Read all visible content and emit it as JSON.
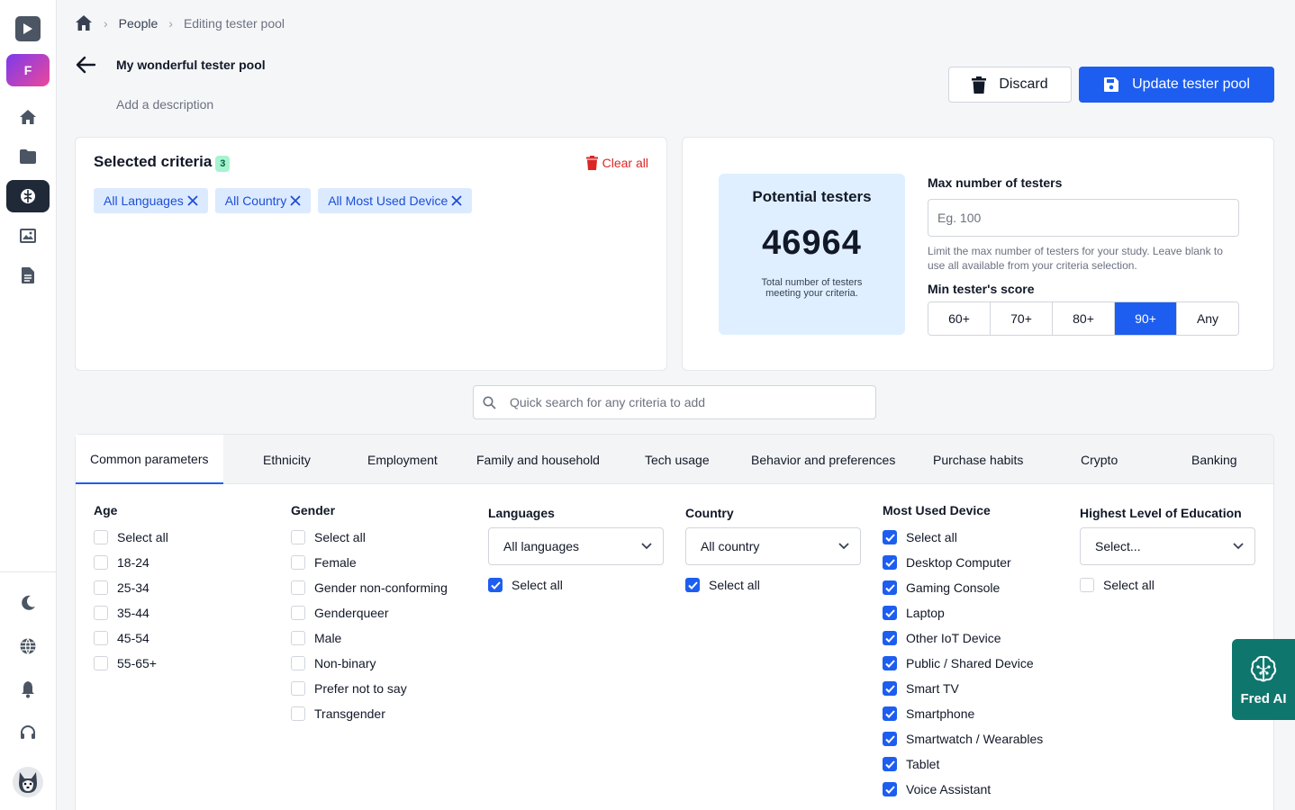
{
  "sidebar": {
    "workspace_initial": "F",
    "icons": [
      "play-logo-icon",
      "home-icon",
      "folder-icon",
      "brain-icon",
      "gallery-icon",
      "document-icon",
      "moon-icon",
      "globe-icon",
      "bell-icon",
      "headset-icon"
    ]
  },
  "breadcrumb": {
    "people": "People",
    "current": "Editing tester pool"
  },
  "pool": {
    "title": "My wonderful tester pool",
    "description_placeholder": "Add a description"
  },
  "actions": {
    "discard": "Discard",
    "update": "Update tester pool"
  },
  "criteria": {
    "title": "Selected criteria",
    "count": "3",
    "clear_all": "Clear all",
    "chips": [
      "All Languages",
      "All Country",
      "All Most Used Device"
    ]
  },
  "potential": {
    "title": "Potential testers",
    "count": "46964",
    "subtitle_line1": "Total number of testers",
    "subtitle_line2": "meeting your criteria.",
    "max_label": "Max number of testers",
    "max_placeholder": "Eg. 100",
    "max_help": "Limit the max number of testers for your study. Leave blank to use all available from your criteria selection.",
    "score_label": "Min tester's score",
    "scores": [
      "60+",
      "70+",
      "80+",
      "90+",
      "Any"
    ],
    "selected_score": "90+"
  },
  "search": {
    "placeholder": "Quick search for any criteria to add"
  },
  "tabs": [
    "Common parameters",
    "Ethnicity",
    "Employment",
    "Family and household",
    "Tech usage",
    "Behavior and preferences",
    "Purchase habits",
    "Crypto",
    "Banking"
  ],
  "params": {
    "age": {
      "title": "Age",
      "options": [
        "Select all",
        "18-24",
        "25-34",
        "35-44",
        "45-54",
        "55-65+"
      ]
    },
    "gender": {
      "title": "Gender",
      "options": [
        "Select all",
        "Female",
        "Gender non-conforming",
        "Genderqueer",
        "Male",
        "Non-binary",
        "Prefer not to say",
        "Transgender"
      ]
    },
    "languages": {
      "title": "Languages",
      "select_value": "All languages",
      "select_all": "Select all"
    },
    "country": {
      "title": "Country",
      "select_value": "All country",
      "select_all": "Select all"
    },
    "device": {
      "title": "Most Used Device",
      "options": [
        "Select all",
        "Desktop Computer",
        "Gaming Console",
        "Laptop",
        "Other IoT Device",
        "Public / Shared Device",
        "Smart TV",
        "Smartphone",
        "Smartwatch / Wearables",
        "Tablet",
        "Voice Assistant"
      ]
    },
    "education": {
      "title": "Highest Level of Education",
      "select_value": "Select...",
      "select_all": "Select all"
    }
  },
  "fred": {
    "label": "Fred AI"
  },
  "colors": {
    "primary": "#1d5ef0",
    "danger": "#dc2626",
    "chip_bg": "#dbeafe",
    "potential_bg": "#e0efff",
    "fred_bg": "#0f766e"
  }
}
